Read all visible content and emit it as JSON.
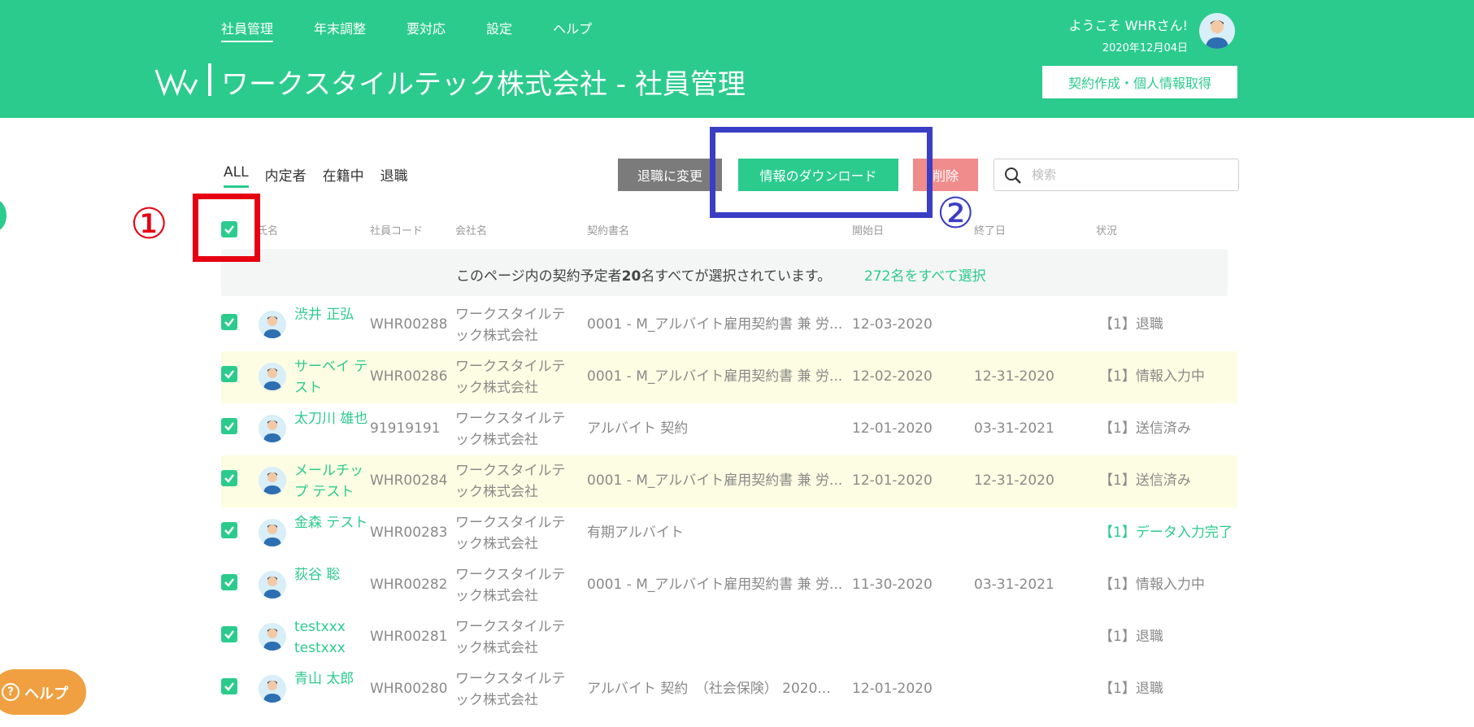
{
  "nav": {
    "items": [
      {
        "label": "社員管理",
        "active": true
      },
      {
        "label": "年末調整",
        "active": false
      },
      {
        "label": "要対応",
        "active": false
      },
      {
        "label": "設定",
        "active": false
      },
      {
        "label": "ヘルプ",
        "active": false
      }
    ]
  },
  "header": {
    "greeting": "ようこそ WHRさん!",
    "date": "2020年12月04日",
    "title": "ワークスタイルテック株式会社 - 社員管理",
    "contract_button": "契約作成・個人情報取得"
  },
  "tabs": [
    {
      "label": "ALL",
      "active": true
    },
    {
      "label": "内定者",
      "active": false
    },
    {
      "label": "在籍中",
      "active": false
    },
    {
      "label": "退職",
      "active": false
    }
  ],
  "toolbar": {
    "retire_label": "退職に変更",
    "download_label": "情報のダウンロード",
    "delete_label": "削除",
    "search_placeholder": "検索"
  },
  "annotations": {
    "marker_1": "①",
    "marker_2": "②"
  },
  "table": {
    "columns": [
      "氏名",
      "社員コード",
      "会社名",
      "契約書名",
      "開始日",
      "終了日",
      "状況"
    ],
    "banner": {
      "prefix": "このページ内の契約予定者",
      "count": "20",
      "suffix": "名すべてが選択されています。",
      "link": "272名をすべて選択"
    },
    "rows": [
      {
        "name": "渋井 正弘",
        "code": "WHR00288",
        "company": "ワークスタイルテック株式会社",
        "contract": "0001 - M_アルバイト雇用契約書 兼 労...",
        "start": "12-03-2020",
        "end": "",
        "status": "【1】退職",
        "status_color": "#8a8a8a",
        "highlight": false
      },
      {
        "name": "サーベイ テスト",
        "code": "WHR00286",
        "company": "ワークスタイルテック株式会社",
        "contract": "0001 - M_アルバイト雇用契約書 兼 労...",
        "start": "12-02-2020",
        "end": "12-31-2020",
        "status": "【1】情報入力中",
        "status_color": "#8a8a8a",
        "highlight": true
      },
      {
        "name": "太刀川 雄也",
        "code": "91919191",
        "company": "ワークスタイルテック株式会社",
        "contract": "アルバイト 契約",
        "start": "12-01-2020",
        "end": "03-31-2021",
        "status": "【1】送信済み",
        "status_color": "#8a8a8a",
        "highlight": false
      },
      {
        "name": "メールチップ テスト",
        "code": "WHR00284",
        "company": "ワークスタイルテック株式会社",
        "contract": "0001 - M_アルバイト雇用契約書 兼 労...",
        "start": "12-01-2020",
        "end": "12-31-2020",
        "status": "【1】送信済み",
        "status_color": "#8a8a8a",
        "highlight": true
      },
      {
        "name": "金森 テスト",
        "code": "WHR00283",
        "company": "ワークスタイルテック株式会社",
        "contract": "有期アルバイト",
        "start": "",
        "end": "",
        "status": "【1】データ入力完了",
        "status_color": "#2bcb8e",
        "highlight": false
      },
      {
        "name": "荻谷 聡",
        "code": "WHR00282",
        "company": "ワークスタイルテック株式会社",
        "contract": "0001 - M_アルバイト雇用契約書 兼 労...",
        "start": "11-30-2020",
        "end": "03-31-2021",
        "status": "【1】情報入力中",
        "status_color": "#8a8a8a",
        "highlight": false
      },
      {
        "name": "testxxx testxxx",
        "code": "WHR00281",
        "company": "ワークスタイルテック株式会社",
        "contract": "",
        "start": "",
        "end": "",
        "status": "【1】退職",
        "status_color": "#8a8a8a",
        "highlight": false
      },
      {
        "name": "青山 太郎",
        "code": "WHR00280",
        "company": "ワークスタイルテック株式会社",
        "contract": "アルバイト 契約　（社会保険） 2020...",
        "start": "12-01-2020",
        "end": "",
        "status": "【1】退職",
        "status_color": "#8a8a8a",
        "highlight": false
      }
    ]
  },
  "help": {
    "label": "ヘルプ"
  },
  "colors": {
    "brand": "#2bcb8e",
    "retire": "#7b7b7b",
    "delete": "#f08c8c",
    "help": "#f0a040",
    "annotation_red": "#e60012",
    "annotation_blue": "#3a3ec5"
  },
  "icons": {
    "logo": "ws-logo-icon",
    "search": "search-icon",
    "check": "check-icon",
    "avatar": "avatar-icon",
    "help": "question-icon"
  }
}
